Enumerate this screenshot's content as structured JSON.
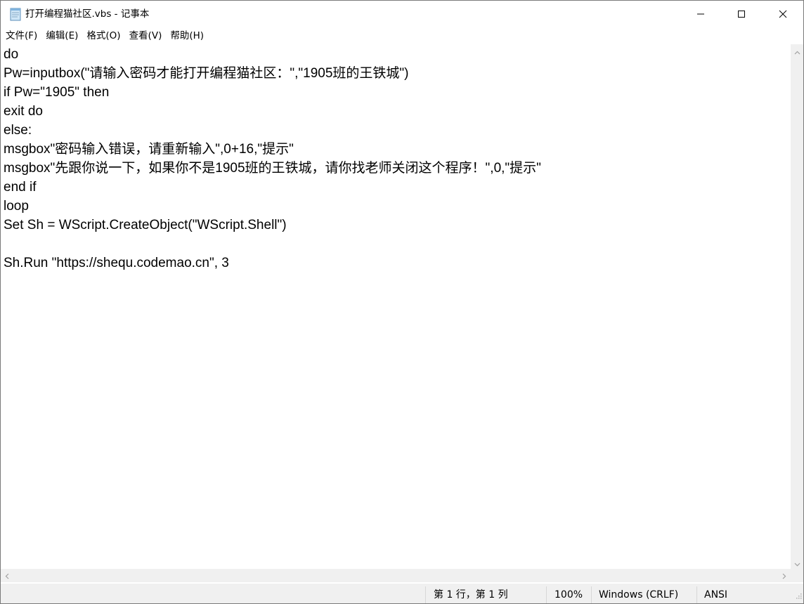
{
  "window": {
    "title": "打开编程猫社区.vbs - 记事本"
  },
  "menu": [
    {
      "label": "文件(F)"
    },
    {
      "label": "编辑(E)"
    },
    {
      "label": "格式(O)"
    },
    {
      "label": "查看(V)"
    },
    {
      "label": "帮助(H)"
    }
  ],
  "editor": {
    "lines": [
      "do",
      "Pw=inputbox(\"请输入密码才能打开编程猫社区：\",\"1905班的王铁城\")",
      "if Pw=\"1905\" then",
      "exit do",
      "else:",
      "msgbox\"密码输入错误，请重新输入\",0+16,\"提示\"",
      "msgbox\"先跟你说一下，如果你不是1905班的王铁城，请你找老师关闭这个程序！\",0,\"提示\"",
      "end if",
      "loop",
      "Set Sh = WScript.CreateObject(\"WScript.Shell\")",
      "",
      "Sh.Run \"https://shequ.codemao.cn\", 3"
    ]
  },
  "status": {
    "position": "第 1 行，第 1 列",
    "zoom": "100%",
    "line_ending": "Windows (CRLF)",
    "encoding": "ANSI"
  },
  "icons": {
    "app": "notepad-icon",
    "minimize": "minimize-icon",
    "maximize": "maximize-icon",
    "close": "close-icon"
  }
}
